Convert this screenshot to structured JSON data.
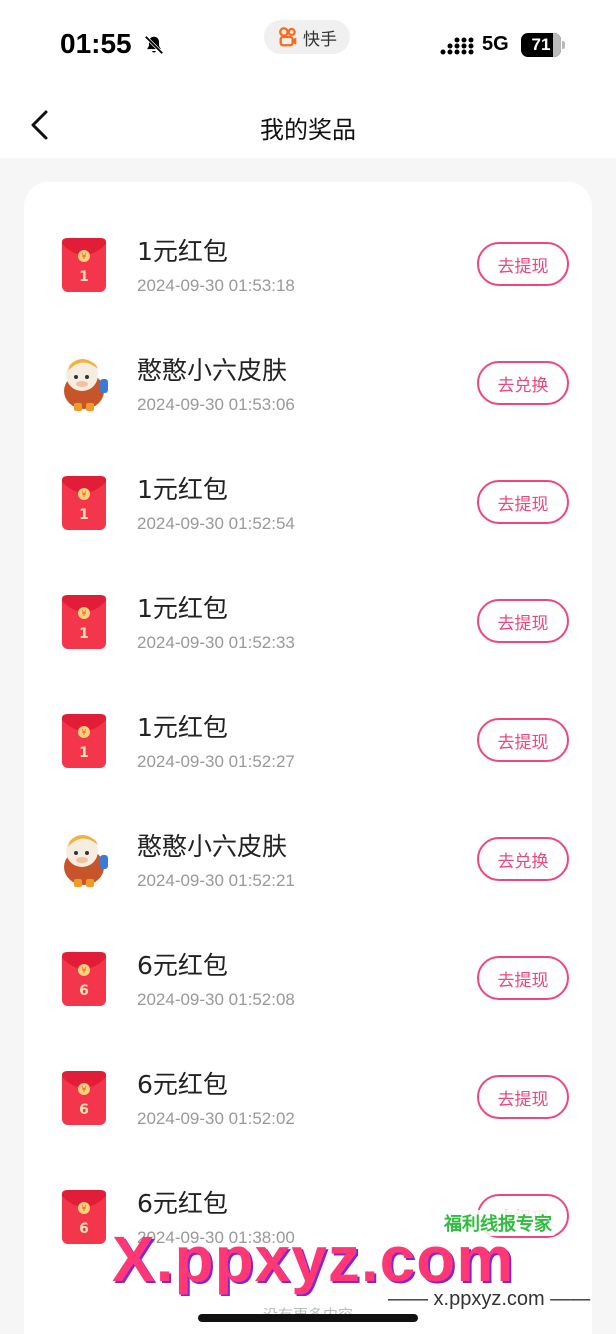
{
  "status_bar": {
    "time": "01:55",
    "app_name": "快手",
    "network": "5G",
    "battery": "71"
  },
  "nav": {
    "title": "我的奖品"
  },
  "items": [
    {
      "title": "1元红包",
      "date": "2024-09-30 01:53:18",
      "button": "去提现",
      "icon": "red-envelope",
      "amount": "1"
    },
    {
      "title": "憨憨小六皮肤",
      "date": "2024-09-30 01:53:06",
      "button": "去兑换",
      "icon": "character-avatar"
    },
    {
      "title": "1元红包",
      "date": "2024-09-30 01:52:54",
      "button": "去提现",
      "icon": "red-envelope",
      "amount": "1"
    },
    {
      "title": "1元红包",
      "date": "2024-09-30 01:52:33",
      "button": "去提现",
      "icon": "red-envelope",
      "amount": "1"
    },
    {
      "title": "1元红包",
      "date": "2024-09-30 01:52:27",
      "button": "去提现",
      "icon": "red-envelope",
      "amount": "1"
    },
    {
      "title": "憨憨小六皮肤",
      "date": "2024-09-30 01:52:21",
      "button": "去兑换",
      "icon": "character-avatar"
    },
    {
      "title": "6元红包",
      "date": "2024-09-30 01:52:08",
      "button": "去提现",
      "icon": "red-envelope",
      "amount": "6"
    },
    {
      "title": "6元红包",
      "date": "2024-09-30 01:52:02",
      "button": "去提现",
      "icon": "red-envelope",
      "amount": "6"
    },
    {
      "title": "6元红包",
      "date": "2024-09-30 01:38:00",
      "button": "去提现",
      "icon": "red-envelope",
      "amount": "6"
    }
  ],
  "footer": {
    "text": "没有更多内容"
  },
  "watermark": {
    "big": "X.ppxyz.com",
    "small": "—— x.ppxyz.com ——",
    "brand": "福利线报专家"
  },
  "colors": {
    "accent": "#f0467a",
    "envelope": "#f4364c"
  }
}
